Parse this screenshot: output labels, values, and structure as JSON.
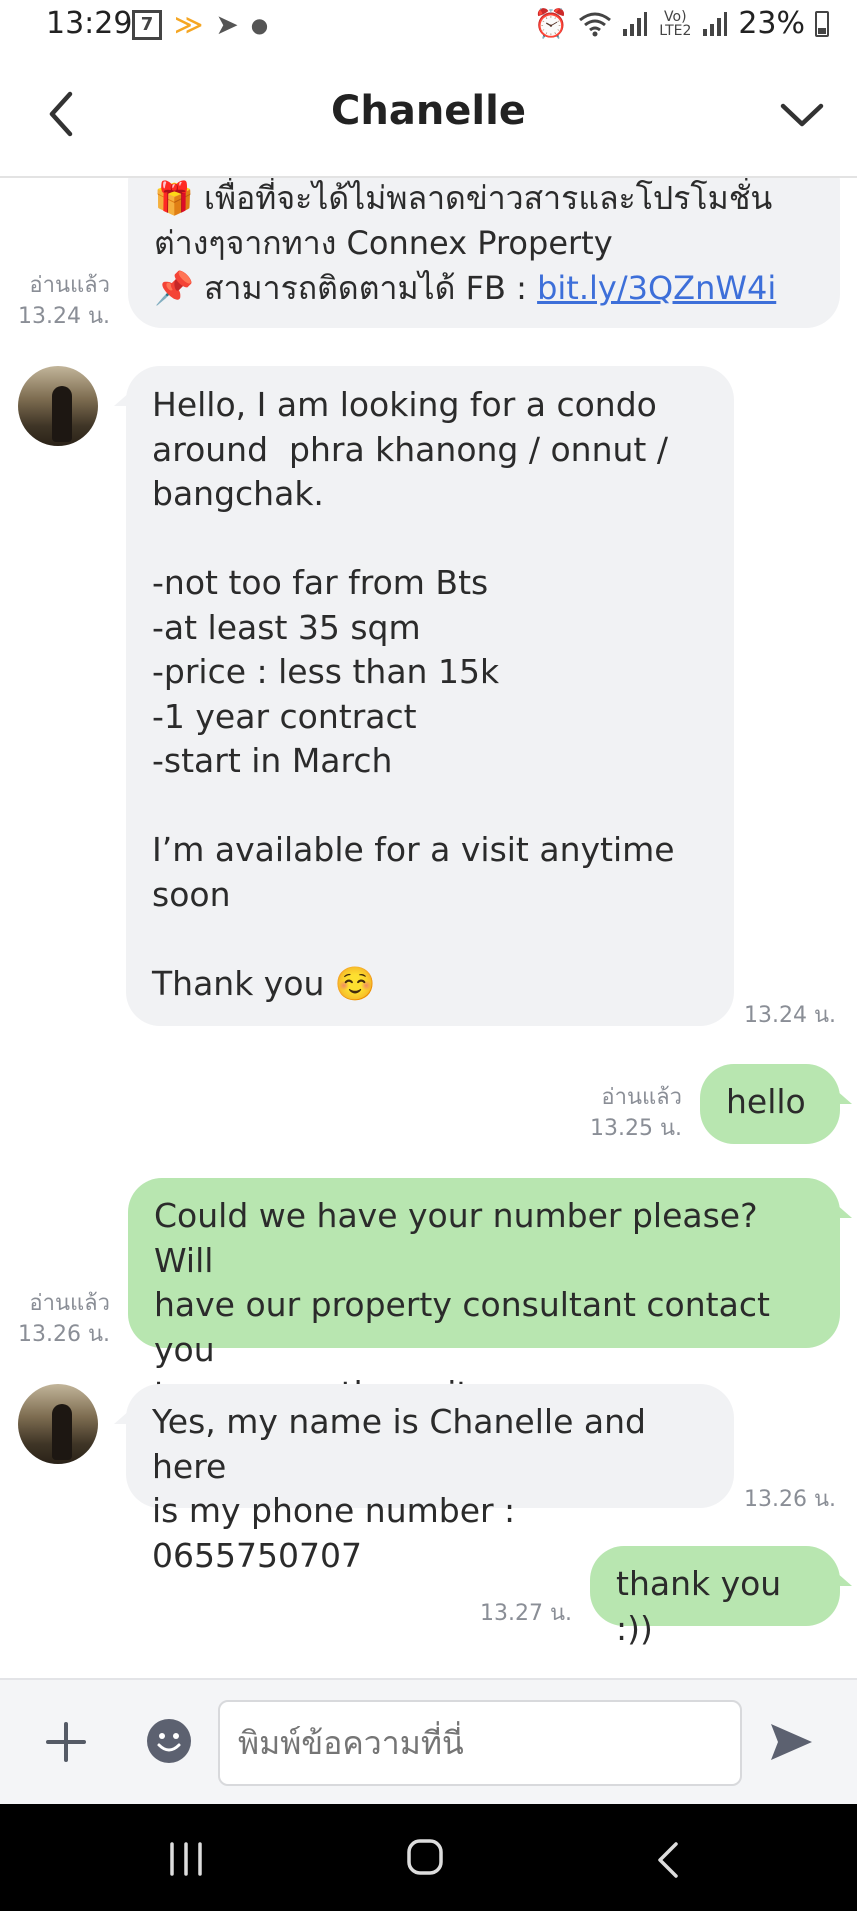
{
  "status_bar": {
    "time": "13:29",
    "battery_percent": "23%",
    "volte_label": "Vo) LTE2"
  },
  "header": {
    "title": "Chanelle"
  },
  "messages": [
    {
      "sender": "self",
      "lines_before_link": "🎁 เพื่อที่จะได้ไม่พลาดข่าวสารและโปรโมชั่น\nต่างๆจากทาง Connex Property\n📌 สามารถติดตามได้ FB : ",
      "link_text": "bit.ly/3QZnW4i",
      "read_label": "อ่านแล้ว",
      "time": "13.24 น."
    },
    {
      "sender": "Chanelle",
      "text": "Hello, I am looking for a condo\naround  phra khanong / onnut /\nbangchak.\n\n-not too far from Bts\n-at least 35 sqm\n-price : less than 15k\n-1 year contract\n-start in March\n\nI’m available for a visit anytime\nsoon\n\nThank you ☺️",
      "time": "13.24 น."
    },
    {
      "sender": "self",
      "text": "hello",
      "read_label": "อ่านแล้ว",
      "time": "13.25 น."
    },
    {
      "sender": "self",
      "text": "Could we have your number please? Will\nhave our property consultant contact you\nto propose the units.",
      "read_label": "อ่านแล้ว",
      "time": "13.26 น."
    },
    {
      "sender": "Chanelle",
      "text": "Yes, my name is Chanelle and here\nis my phone number : 0655750707",
      "time": "13.26 น."
    },
    {
      "sender": "self",
      "text": "thank you :))",
      "time": "13.27 น."
    }
  ],
  "composer": {
    "placeholder": "พิมพ์ข้อความที่นี่"
  },
  "colors": {
    "outgoing_bubble": "#b8e6b0",
    "incoming_bubble": "#f1f2f4",
    "link": "#3d6fd9",
    "meta_text": "#8a8e96"
  },
  "icons": [
    "back-arrow-icon",
    "chevron-down-icon",
    "plus-icon",
    "emoji-icon",
    "send-icon",
    "recent-apps-icon",
    "home-icon",
    "nav-back-icon"
  ]
}
